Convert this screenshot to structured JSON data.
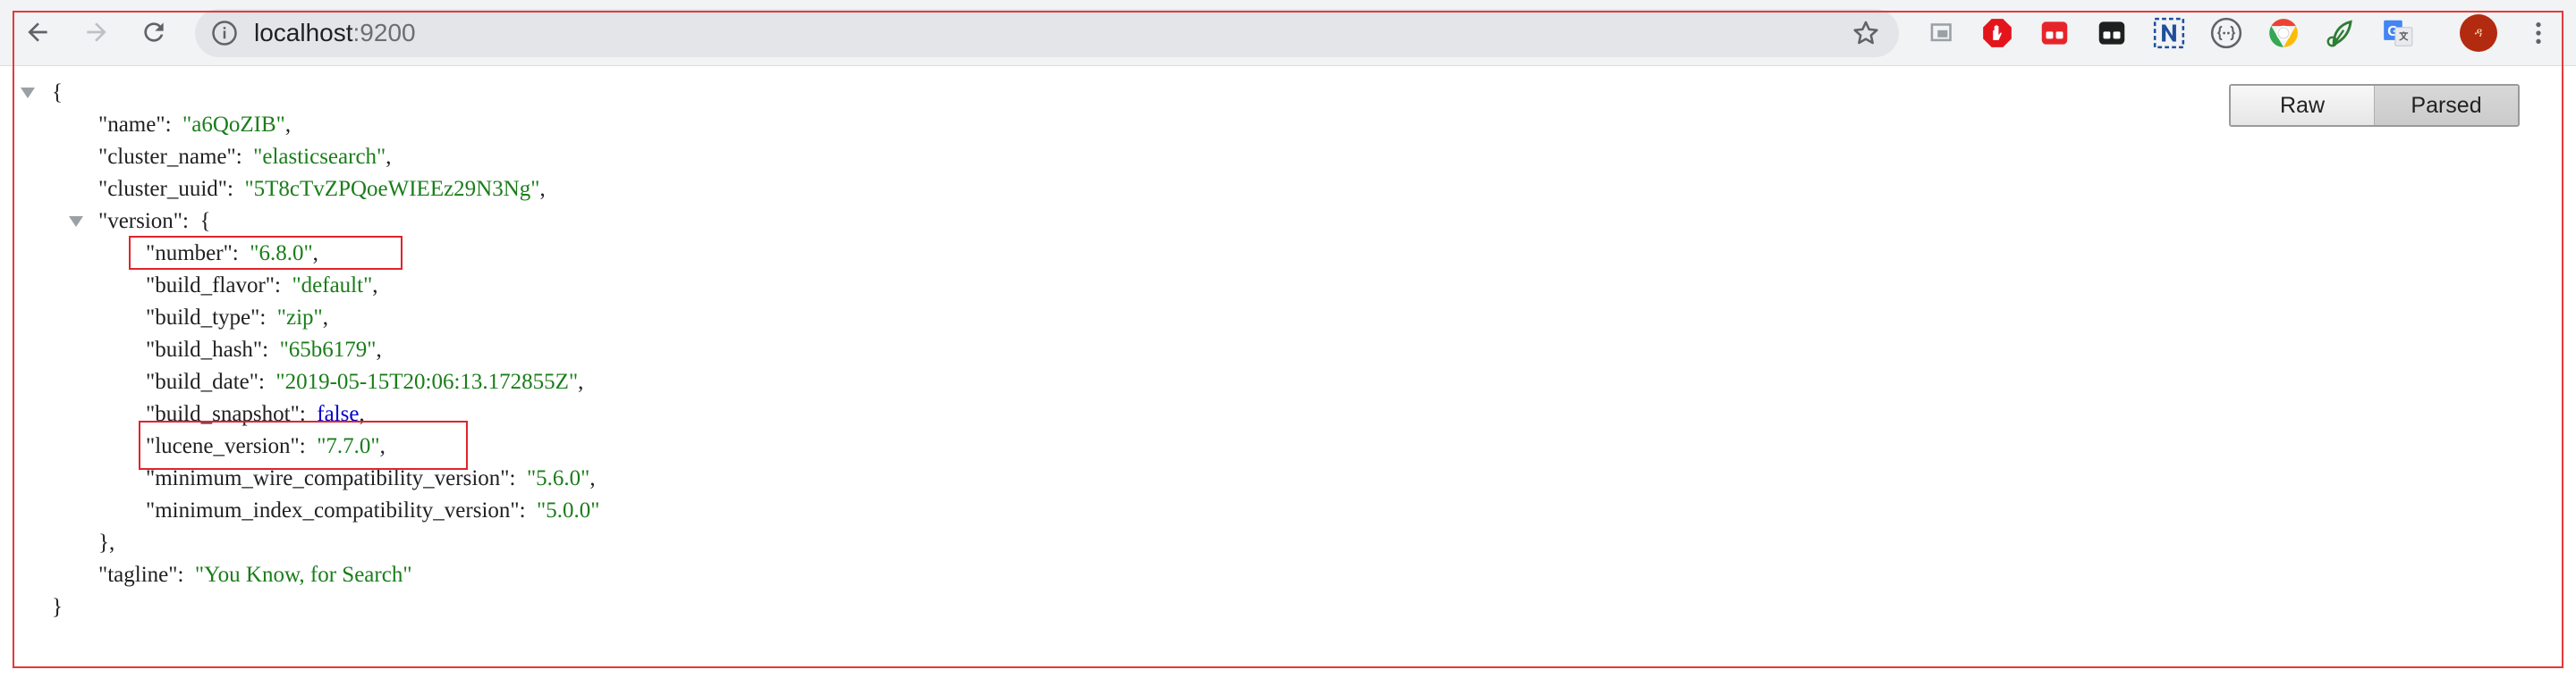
{
  "browser": {
    "url_host": "localhost",
    "url_port": ":9200",
    "icons": {
      "back": "back-arrow-icon",
      "forward": "forward-arrow-icon",
      "reload": "reload-icon",
      "info": "info-icon",
      "bookmark": "star-icon",
      "menu": "three-dot-menu-icon"
    },
    "extensions": [
      "cast-icon",
      "adblock-icon",
      "red-extension-icon",
      "dark-extension-icon",
      "n-extension-icon",
      "json-extension-icon",
      "chrome-color-icon",
      "leaf-extension-icon",
      "translate-icon"
    ],
    "avatar_text": "ዳ"
  },
  "viewer": {
    "toggle": {
      "raw_label": "Raw",
      "parsed_label": "Parsed",
      "active": "Parsed"
    }
  },
  "json": {
    "open_brace": "{",
    "close_brace": "}",
    "name_key": "\"name\"",
    "name_value": "\"a6QoZIB\"",
    "cluster_name_key": "\"cluster_name\"",
    "cluster_name_value": "\"elasticsearch\"",
    "cluster_uuid_key": "\"cluster_uuid\"",
    "cluster_uuid_value": "\"5T8cTvZPQoeWIEEz29N3Ng\"",
    "version_key": "\"version\"",
    "version_open": "{",
    "version": {
      "number_key": "\"number\"",
      "number_value": "\"6.8.0\"",
      "build_flavor_key": "\"build_flavor\"",
      "build_flavor_value": "\"default\"",
      "build_type_key": "\"build_type\"",
      "build_type_value": "\"zip\"",
      "build_hash_key": "\"build_hash\"",
      "build_hash_value": "\"65b6179\"",
      "build_date_key": "\"build_date\"",
      "build_date_value": "\"2019-05-15T20:06:13.172855Z\"",
      "build_snapshot_key": "\"build_snapshot\"",
      "build_snapshot_value": "false",
      "lucene_version_key": "\"lucene_version\"",
      "lucene_version_value": "\"7.7.0\"",
      "min_wire_key": "\"minimum_wire_compatibility_version\"",
      "min_wire_value": "\"5.6.0\"",
      "min_index_key": "\"minimum_index_compatibility_version\"",
      "min_index_value": "\"5.0.0\""
    },
    "version_close": "},",
    "tagline_key": "\"tagline\"",
    "tagline_value": "\"You Know, for Search\""
  },
  "colors": {
    "string": "#1a7d1a",
    "boolean": "#0000cc",
    "highlight_box": "#e0242b"
  }
}
